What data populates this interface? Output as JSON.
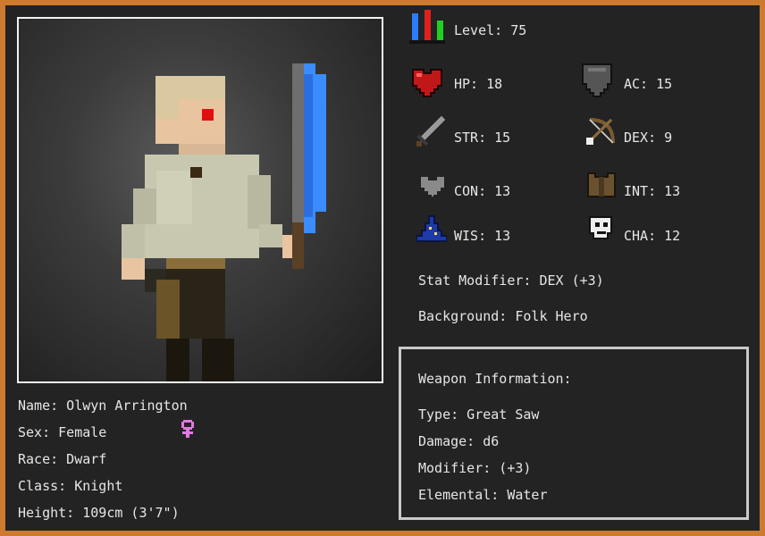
{
  "stats": {
    "level": "Level: 75",
    "hp": "HP: 18",
    "ac": "AC: 15",
    "str": "STR: 15",
    "dex": "DEX: 9",
    "con": "CON: 13",
    "int": "INT: 13",
    "wis": "WIS: 13",
    "cha": "CHA: 12"
  },
  "stat_modifier": "Stat Modifier: DEX (+3)",
  "background": "Background: Folk Hero",
  "character": {
    "name": "Name: Olwyn Arrington",
    "sex": "Sex: Female",
    "race": "Race: Dwarf",
    "class": "Class: Knight",
    "height": "Height: 109cm (3'7\")"
  },
  "weapon": {
    "heading": "Weapon Information:",
    "type": "Type: Great Saw",
    "damage": "Damage: d6",
    "modifier": "Modifier: (+3)",
    "elemental": "Elemental: Water"
  },
  "icons": {
    "level": "level-bars-icon",
    "hp": "heart-icon",
    "ac": "shield-icon",
    "str": "sword-icon",
    "dex": "bow-icon",
    "con": "gray-heart-icon",
    "int": "armor-icon",
    "wis": "wizard-hat-icon",
    "cha": "mask-icon",
    "sex": "female-symbol-icon"
  },
  "colors": {
    "frame": "#cc7a2e",
    "background": "#232323",
    "text": "#e6e6e6",
    "female_symbol": "#e07ae0",
    "blade": "#3a8cff"
  }
}
